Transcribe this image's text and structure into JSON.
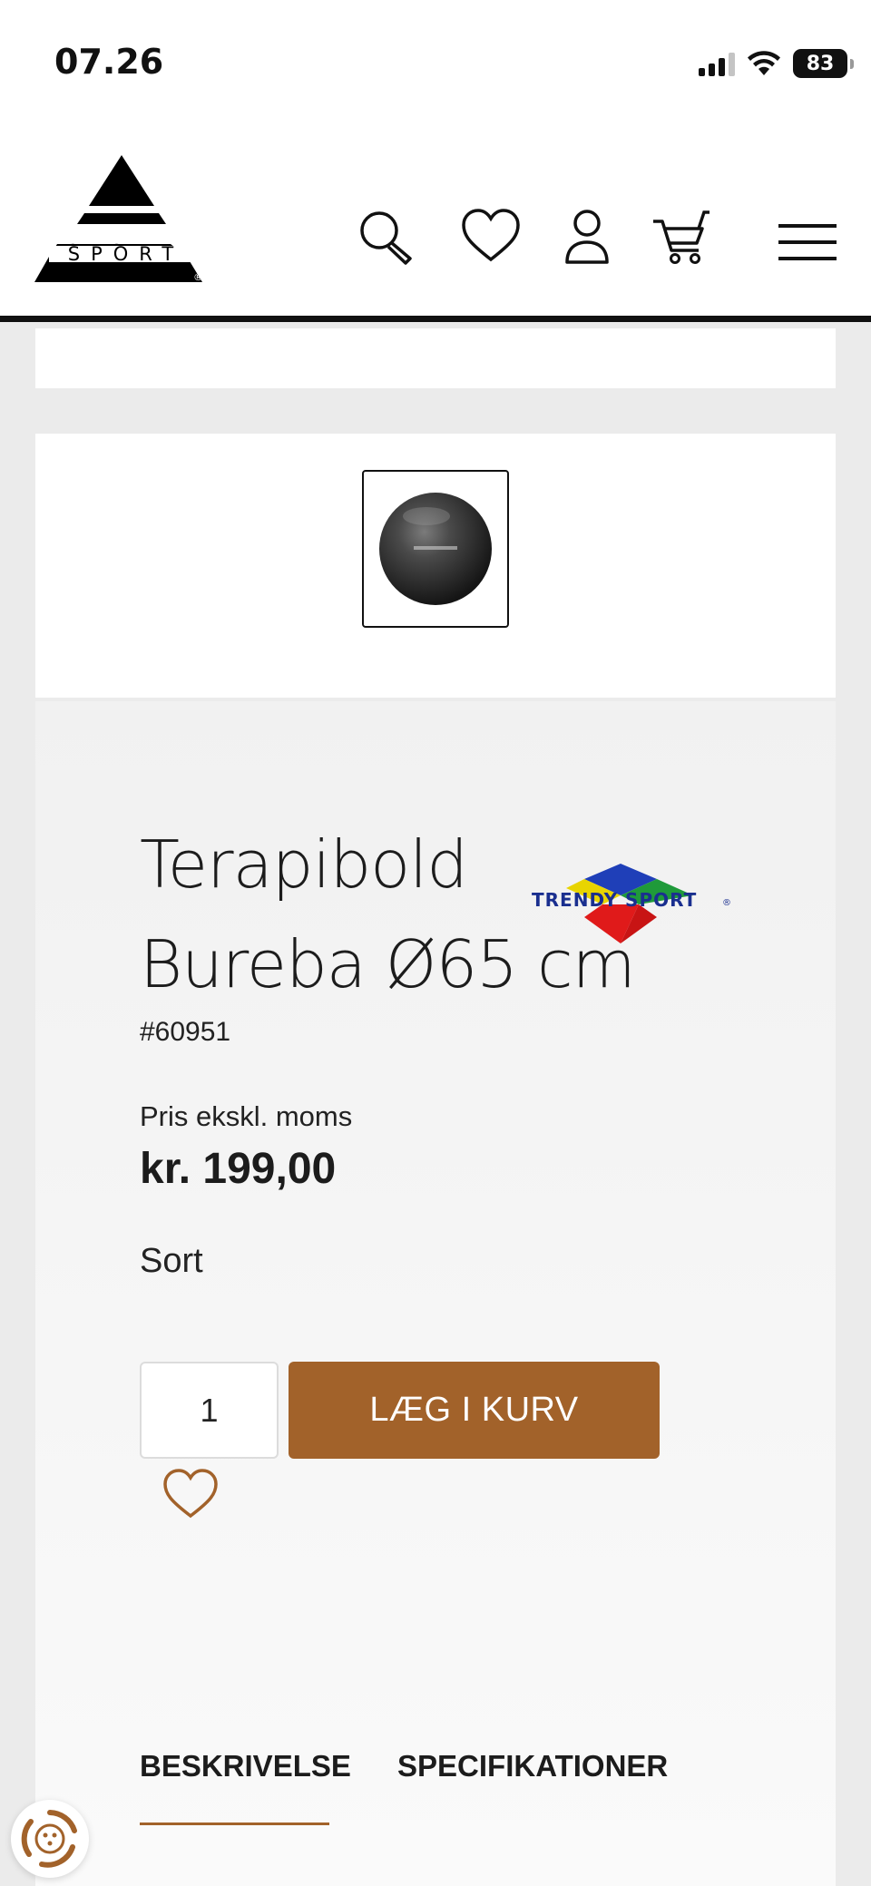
{
  "status_bar": {
    "time": "07.26",
    "battery": "83"
  },
  "header": {
    "logo_text": "SPORT",
    "icons": [
      "search-icon",
      "heart-icon",
      "user-icon",
      "cart-icon",
      "menu-icon"
    ]
  },
  "product": {
    "title_line1": "Terapibold",
    "title_line2": "Bureba Ø65 cm",
    "brand": "TRENDY SPORT",
    "sku": "#60951",
    "price_label": "Pris ekskl. moms",
    "price": "kr. 199,00",
    "variant": "Sort",
    "quantity": "1",
    "add_to_cart_label": "LÆG I KURV"
  },
  "tabs": [
    {
      "label": "BESKRIVELSE",
      "active": true
    },
    {
      "label": "SPECIFIKATIONER",
      "active": false
    }
  ],
  "colors": {
    "accent": "#a2622a",
    "text": "#1c1c1c"
  }
}
